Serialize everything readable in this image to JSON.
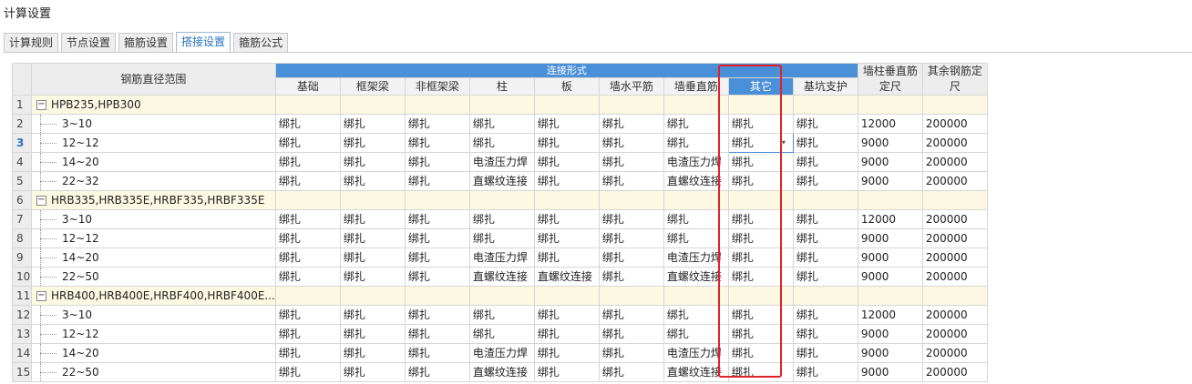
{
  "window": {
    "title": "计算设置"
  },
  "tabs": [
    {
      "label": "计算规则",
      "active": false
    },
    {
      "label": "节点设置",
      "active": false
    },
    {
      "label": "箍筋设置",
      "active": false
    },
    {
      "label": "搭接设置",
      "active": true
    },
    {
      "label": "箍筋公式",
      "active": false
    }
  ],
  "table": {
    "range_header": "钢筋直径范围",
    "group_header": "连接形式",
    "columns": [
      "基础",
      "框架梁",
      "非框架梁",
      "柱",
      "板",
      "墙水平筋",
      "墙垂直筋",
      "其它",
      "基坑支护"
    ],
    "wall_col_length_header": "墙柱垂直筋定尺",
    "other_length_header": "其余钢筋定尺",
    "selected_column": "其它",
    "current_row": "3",
    "rows": [
      {
        "n": "1",
        "group": true,
        "label": "HPB235,HPB300",
        "toggle": "−"
      },
      {
        "n": "2",
        "label": "3~10",
        "cells": [
          "绑扎",
          "绑扎",
          "绑扎",
          "绑扎",
          "绑扎",
          "绑扎",
          "绑扎",
          "绑扎",
          "绑扎"
        ],
        "len1": "12000",
        "len2": "200000"
      },
      {
        "n": "3",
        "label": "12~12",
        "cells": [
          "绑扎",
          "绑扎",
          "绑扎",
          "绑扎",
          "绑扎",
          "绑扎",
          "绑扎",
          "绑扎",
          "绑扎"
        ],
        "len1": "9000",
        "len2": "200000"
      },
      {
        "n": "4",
        "label": "14~20",
        "cells": [
          "绑扎",
          "绑扎",
          "绑扎",
          "电渣压力焊",
          "绑扎",
          "绑扎",
          "电渣压力焊",
          "绑扎",
          "绑扎"
        ],
        "len1": "9000",
        "len2": "200000"
      },
      {
        "n": "5",
        "label": "22~32",
        "cells": [
          "绑扎",
          "绑扎",
          "绑扎",
          "直螺纹连接",
          "绑扎",
          "绑扎",
          "直螺纹连接",
          "绑扎",
          "绑扎"
        ],
        "len1": "9000",
        "len2": "200000"
      },
      {
        "n": "6",
        "group": true,
        "label": "HRB335,HRB335E,HRBF335,HRBF335E",
        "toggle": "−"
      },
      {
        "n": "7",
        "label": "3~10",
        "cells": [
          "绑扎",
          "绑扎",
          "绑扎",
          "绑扎",
          "绑扎",
          "绑扎",
          "绑扎",
          "绑扎",
          "绑扎"
        ],
        "len1": "12000",
        "len2": "200000"
      },
      {
        "n": "8",
        "label": "12~12",
        "cells": [
          "绑扎",
          "绑扎",
          "绑扎",
          "绑扎",
          "绑扎",
          "绑扎",
          "绑扎",
          "绑扎",
          "绑扎"
        ],
        "len1": "9000",
        "len2": "200000"
      },
      {
        "n": "9",
        "label": "14~20",
        "cells": [
          "绑扎",
          "绑扎",
          "绑扎",
          "电渣压力焊",
          "绑扎",
          "绑扎",
          "电渣压力焊",
          "绑扎",
          "绑扎"
        ],
        "len1": "9000",
        "len2": "200000"
      },
      {
        "n": "10",
        "label": "22~50",
        "cells": [
          "绑扎",
          "绑扎",
          "绑扎",
          "直螺纹连接",
          "直螺纹连接",
          "绑扎",
          "直螺纹连接",
          "绑扎",
          "绑扎"
        ],
        "len1": "9000",
        "len2": "200000"
      },
      {
        "n": "11",
        "group": true,
        "label": "HRB400,HRB400E,HRBF400,HRBF400E...",
        "toggle": "−"
      },
      {
        "n": "12",
        "label": "3~10",
        "cells": [
          "绑扎",
          "绑扎",
          "绑扎",
          "绑扎",
          "绑扎",
          "绑扎",
          "绑扎",
          "绑扎",
          "绑扎"
        ],
        "len1": "12000",
        "len2": "200000"
      },
      {
        "n": "13",
        "label": "12~12",
        "cells": [
          "绑扎",
          "绑扎",
          "绑扎",
          "绑扎",
          "绑扎",
          "绑扎",
          "绑扎",
          "绑扎",
          "绑扎"
        ],
        "len1": "9000",
        "len2": "200000"
      },
      {
        "n": "14",
        "label": "14~20",
        "cells": [
          "绑扎",
          "绑扎",
          "绑扎",
          "电渣压力焊",
          "绑扎",
          "绑扎",
          "电渣压力焊",
          "绑扎",
          "绑扎"
        ],
        "len1": "9000",
        "len2": "200000"
      },
      {
        "n": "15",
        "label": "22~50",
        "cells": [
          "绑扎",
          "绑扎",
          "绑扎",
          "直螺纹连接",
          "绑扎",
          "绑扎",
          "直螺纹连接",
          "绑扎",
          "绑扎"
        ],
        "len1": "9000",
        "len2": "200000"
      }
    ]
  },
  "colors": {
    "accent": "#4a90d9",
    "group_row_bg": "#fdf8e2",
    "highlight_border": "#e0222a"
  },
  "icons": {
    "collapse": "minus-box-icon",
    "dropdown": "caret-down-icon"
  }
}
